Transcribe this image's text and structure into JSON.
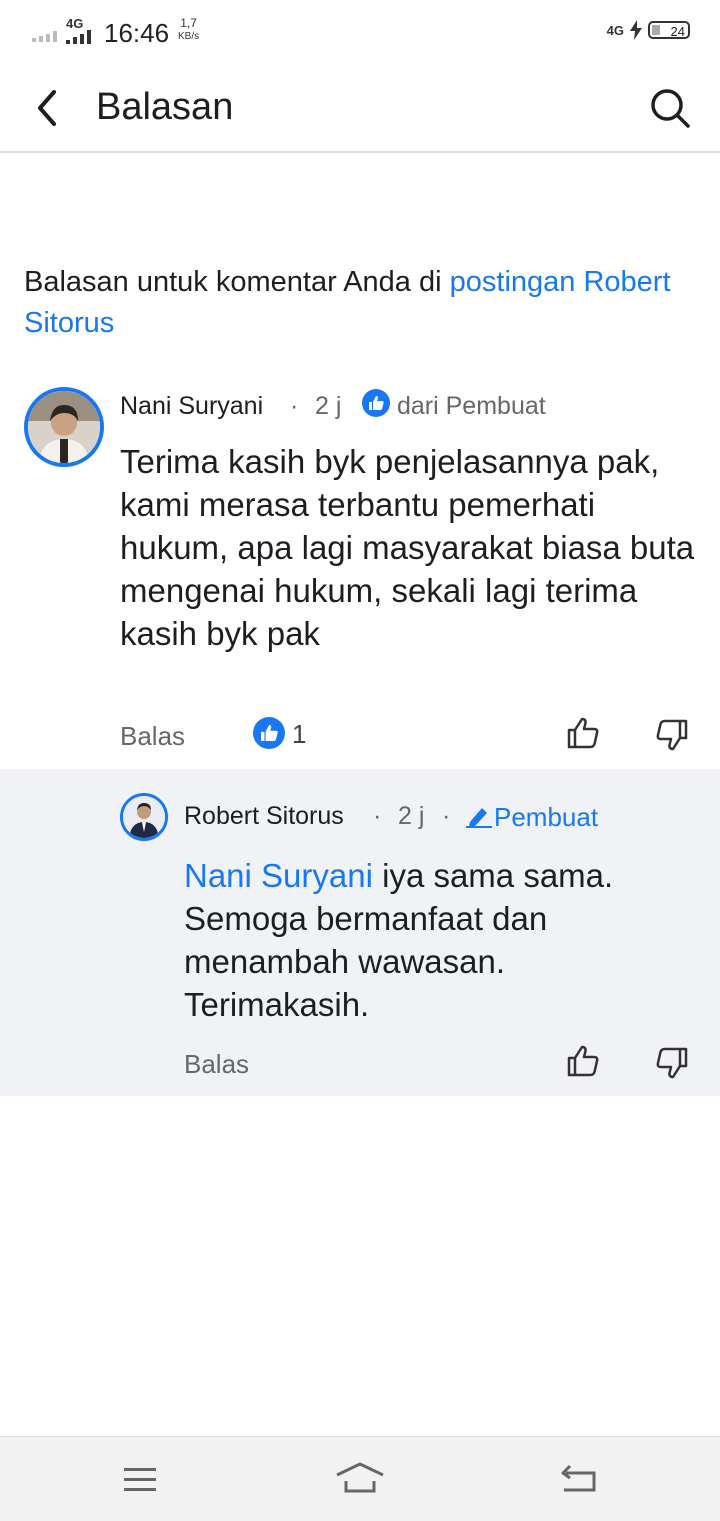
{
  "status_bar": {
    "network": "4G",
    "time": "16:46",
    "speed_value": "1,7",
    "speed_unit": "KB/s",
    "right_network": "4G",
    "battery": "24"
  },
  "header": {
    "title": "Balasan",
    "back_icon": "chevron-left-icon",
    "search_icon": "search-icon"
  },
  "intro": {
    "prefix": "Balasan untuk komentar Anda di ",
    "link_text": "postingan Robert Sitorus"
  },
  "comment": {
    "author": "Nani Suryani",
    "time": "2 j",
    "badge": "dari Pembuat",
    "text": "Terima kasih byk penjelasannya pak, kami merasa terbantu pemerhati hukum, apa lagi masyarakat biasa buta mengenai hukum, sekali lagi terima kasih byk pak",
    "reply_label": "Balas",
    "like_count": "1"
  },
  "reply": {
    "author": "Robert Sitorus",
    "time": "2 j",
    "badge": "Pembuat",
    "mention": "Nani Suryani",
    "text": " iya sama sama. Semoga bermanfaat dan menambah wawasan. Terimakasih.",
    "reply_label": "Balas"
  },
  "colors": {
    "accent": "#1877f2",
    "reply_background": "#f0f2f5",
    "secondary_text": "#65676b"
  }
}
